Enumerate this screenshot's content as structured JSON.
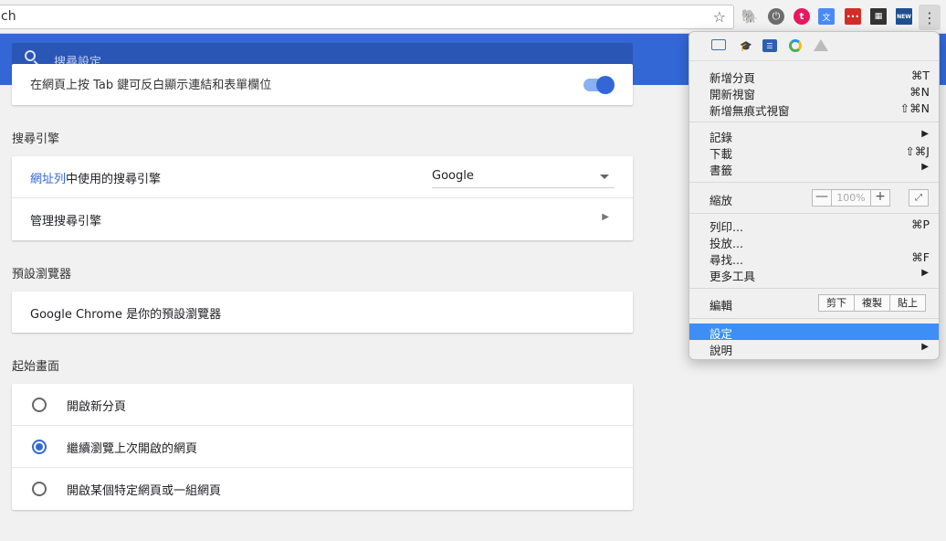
{
  "omnibox": {
    "text": "ch",
    "star_icon": "☆"
  },
  "extensions": [
    "evernote-icon",
    "power-icon",
    "tumblr-icon",
    "translate-icon",
    "lastpass-icon",
    "film-icon",
    "news-icon"
  ],
  "extension_labels": {
    "lastpass": "•••",
    "news": "NEW"
  },
  "menu_button": "⋮",
  "search": {
    "placeholder": "搜尋設定"
  },
  "partial_row": {
    "text": "在網頁上按 Tab 鍵可反白顯示連結和表單欄位"
  },
  "search_engine": {
    "heading": "搜尋引擎",
    "row1_link": "網址列",
    "row1_rest": "中使用的搜尋引擎",
    "row1_value": "Google",
    "row2": "管理搜尋引擎"
  },
  "default_browser": {
    "heading": "預設瀏覽器",
    "text": "Google Chrome 是你的預設瀏覽器"
  },
  "startup": {
    "heading": "起始畫面",
    "options": [
      "開啟新分頁",
      "繼續瀏覽上次開啟的網頁",
      "開啟某個特定網頁或一組網頁"
    ],
    "selected": 1
  },
  "chrome_menu": {
    "group1": [
      {
        "label": "新增分頁",
        "shortcut": "⌘T"
      },
      {
        "label": "開新視窗",
        "shortcut": "⌘N"
      },
      {
        "label": "新增無痕式視窗",
        "shortcut": "⇧⌘N"
      }
    ],
    "group2": [
      {
        "label": "記錄",
        "shortcut": "▶"
      },
      {
        "label": "下載",
        "shortcut": "⇧⌘J"
      },
      {
        "label": "書籤",
        "shortcut": "▶"
      }
    ],
    "zoom": {
      "label": "縮放",
      "minus": "—",
      "value": "100%",
      "plus": "+",
      "fullscreen": "⤢"
    },
    "group3": [
      {
        "label": "列印...",
        "shortcut": "⌘P"
      },
      {
        "label": "投放...",
        "shortcut": ""
      },
      {
        "label": "尋找...",
        "shortcut": "⌘F"
      },
      {
        "label": "更多工具",
        "shortcut": "▶"
      }
    ],
    "edit": {
      "label": "編輯",
      "cut": "剪下",
      "copy": "複製",
      "paste": "貼上"
    },
    "group4": [
      {
        "label": "設定",
        "shortcut": ""
      },
      {
        "label": "說明",
        "shortcut": "▶"
      }
    ]
  },
  "colors": {
    "accent": "#3367d6",
    "menu_highlight": "#3d8ef5"
  }
}
